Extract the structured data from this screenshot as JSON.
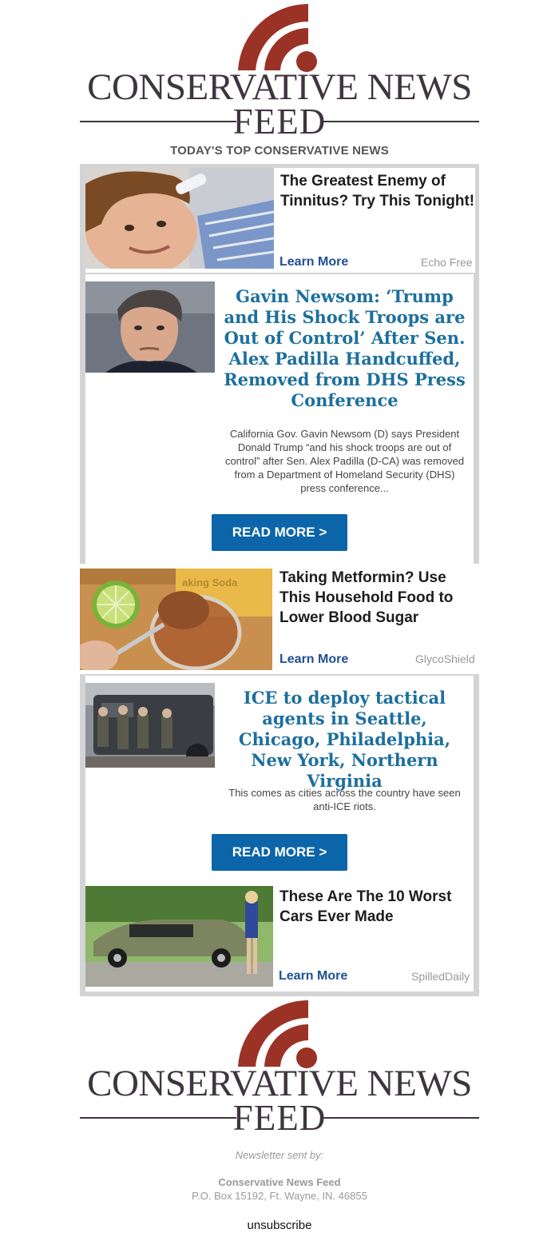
{
  "brand": {
    "line1": "CONSERVATIVE NEWS",
    "line2": "FEED",
    "logo_color": "#9b3226",
    "text_color": "#3f3540"
  },
  "section_heading": "TODAY'S TOP CONSERVATIVE NEWS",
  "ads": [
    {
      "title": "The Greatest Enemy of Tinnitus? Try This Tonight!",
      "link": "Learn More",
      "source": "Echo Free",
      "image": "man-with-eyedropper-photo"
    },
    {
      "title": "Taking Metformin? Use This Household Food to Lower Blood Sugar",
      "link": "Learn More",
      "source": "GlycoShield",
      "image": "cinnamon-spoon-lime-photo"
    },
    {
      "title": "These Are The 10 Worst Cars Ever Made",
      "link": "Learn More",
      "source": "SpilledDaily",
      "image": "green-muscle-car-photo"
    }
  ],
  "articles": [
    {
      "title": "Gavin Newsom: ‘Trump and His Shock Troops are Out of Control’ After Sen. Alex Padilla Handcuffed, Removed from DHS Press Conference",
      "description": "California Gov. Gavin Newsom (D) says President Donald Trump “and his shock troops are out of control” after Sen. Alex Padilla (D-CA) was removed from a Department of Homeland Security (DHS) press conference...",
      "button": "READ MORE >",
      "image": "gavin-newsom-portrait-photo"
    },
    {
      "title": "ICE to deploy tactical agents in Seattle, Chicago, Philadelphia, New York, Northern Virginia",
      "description": "This comes as cities across the country have seen anti-ICE riots.",
      "button": "READ MORE >",
      "image": "tactical-agents-armored-vehicle-photo"
    }
  ],
  "footer": {
    "sent_by": "Newsletter sent by:",
    "company": "Conservative News Feed",
    "address": "P.O. Box 15192, Ft. Wayne, IN. 46855",
    "unsubscribe": "unsubscribe"
  }
}
